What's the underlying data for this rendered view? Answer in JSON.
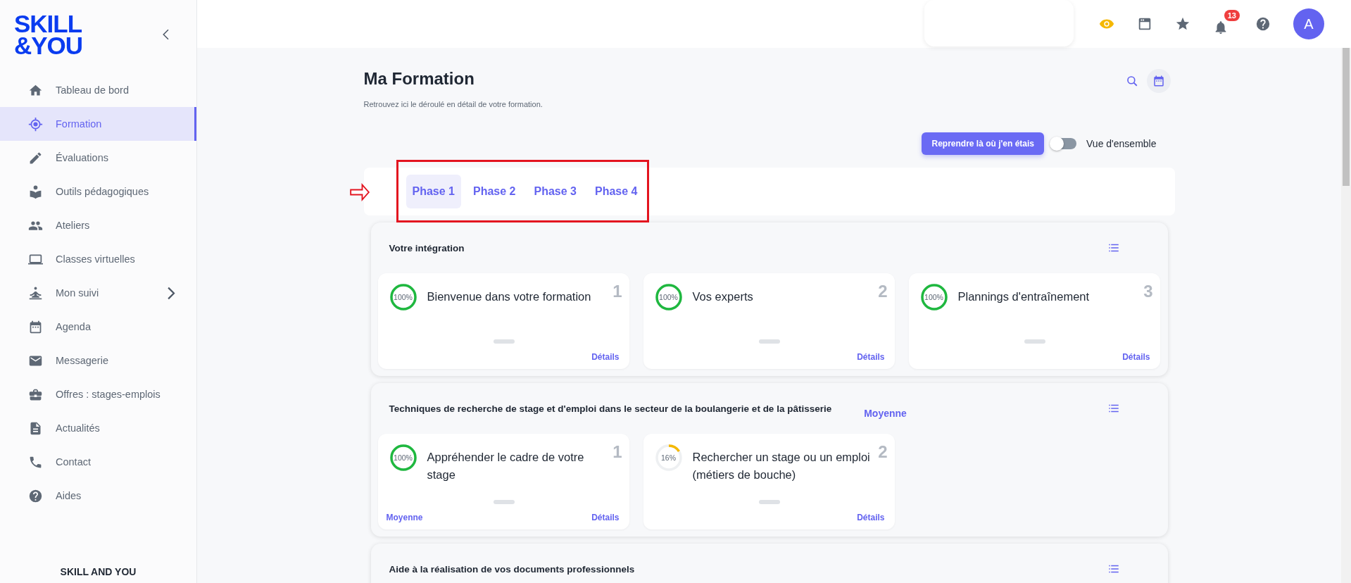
{
  "logo": {
    "lines": [
      "SKILL",
      "&YOU"
    ]
  },
  "sidebar": {
    "items": [
      {
        "label": "Tableau de bord",
        "selected": false
      },
      {
        "label": "Formation",
        "selected": true
      },
      {
        "label": "Évaluations",
        "selected": false
      },
      {
        "label": "Outils pédagogiques",
        "selected": false
      },
      {
        "label": "Ateliers",
        "selected": false
      },
      {
        "label": "Classes virtuelles",
        "selected": false
      },
      {
        "label": "Mon suivi",
        "selected": false,
        "has_submenu": true
      },
      {
        "label": "Agenda",
        "selected": false
      },
      {
        "label": "Messagerie",
        "selected": false
      },
      {
        "label": "Offres : stages-emplois",
        "selected": false
      },
      {
        "label": "Actualités",
        "selected": false
      },
      {
        "label": "Contact",
        "selected": false
      },
      {
        "label": "Aides",
        "selected": false
      }
    ],
    "footer": "SKILL AND YOU"
  },
  "header": {
    "notification_count": "13",
    "avatar_initial": "A"
  },
  "page": {
    "title": "Ma Formation",
    "subtitle": "Retrouvez ici le déroulé en détail de votre formation."
  },
  "resume_button": "Reprendre là où j'en étais",
  "overview_toggle": {
    "label": "Vue d'ensemble",
    "on": false
  },
  "tabs": [
    {
      "label": "Phase 1",
      "selected": true
    },
    {
      "label": "Phase 2",
      "selected": false
    },
    {
      "label": "Phase 3",
      "selected": false
    },
    {
      "label": "Phase 4",
      "selected": false
    }
  ],
  "sections": [
    {
      "title": "Votre intégration",
      "modules": [
        {
          "number": "1",
          "title": "Bienvenue dans votre formation",
          "progress": "100%",
          "level": 1,
          "details": "Détails"
        },
        {
          "number": "2",
          "title": "Vos experts",
          "progress": "100%",
          "level": 1,
          "details": "Détails"
        },
        {
          "number": "3",
          "title": "Plannings d'entraînement",
          "progress": "100%",
          "level": 1,
          "details": "Détails"
        }
      ]
    },
    {
      "title": "Techniques de recherche de stage et d'emploi dans le secteur de la boulangerie et de la pâtisserie",
      "badge": "Moyenne",
      "modules": [
        {
          "number": "1",
          "title": "Appréhender le cadre de votre stage",
          "progress": "100%",
          "level": 1,
          "badge": "Moyenne",
          "details": "Détails"
        },
        {
          "number": "2",
          "title": "Rechercher un stage ou un emploi (métiers de bouche)",
          "progress": "16%",
          "level": 0.16,
          "details": "Détails"
        }
      ]
    },
    {
      "title": "Aide à la réalisation de vos documents professionnels"
    }
  ]
}
